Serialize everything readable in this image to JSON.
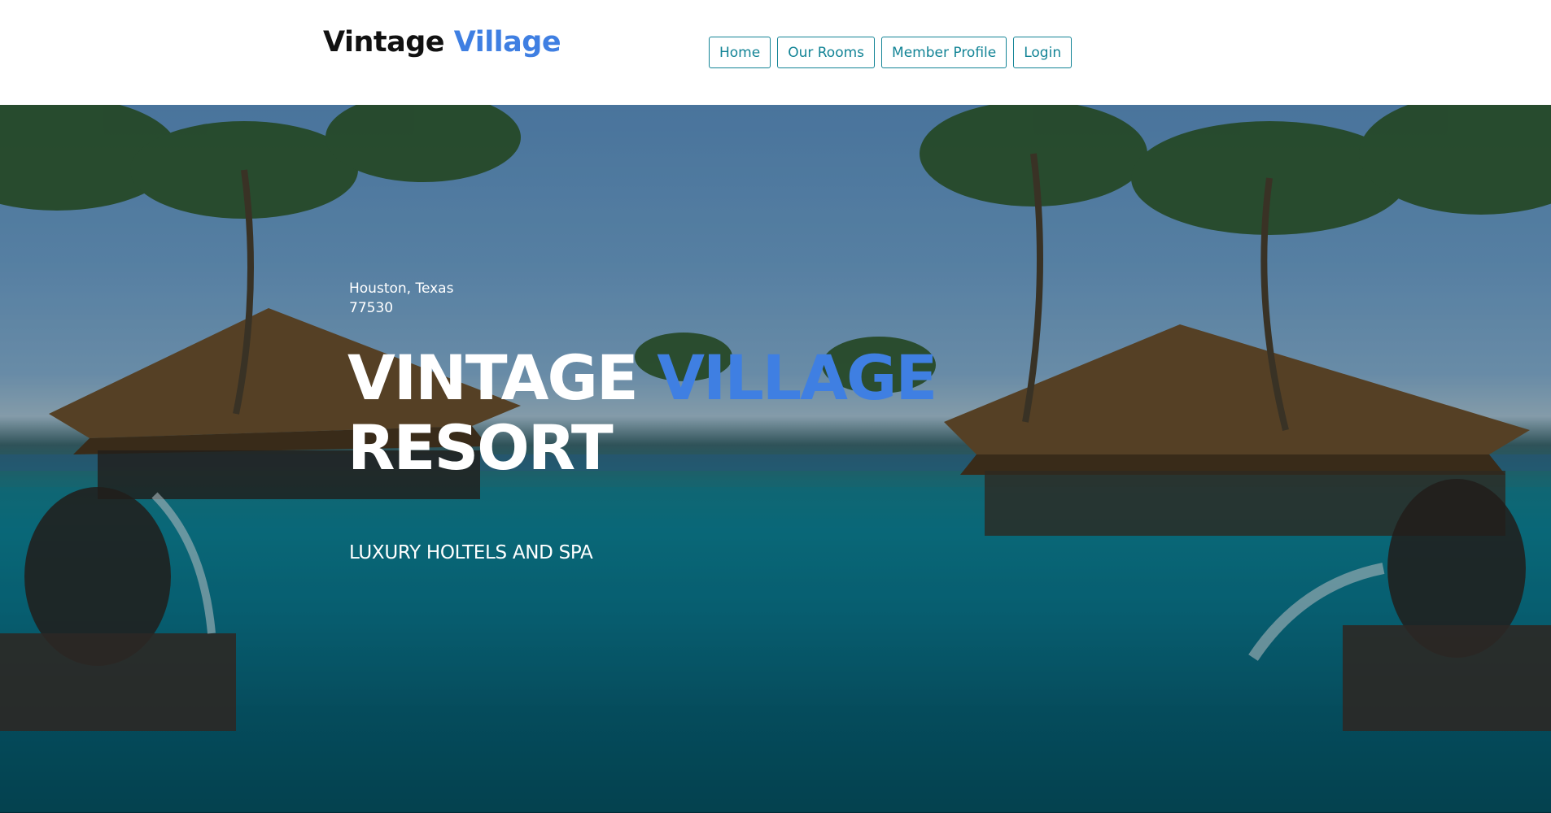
{
  "header": {
    "brand_part1": "Vintage",
    "brand_part2": "Village",
    "nav": [
      {
        "label": "Home"
      },
      {
        "label": "Our Rooms"
      },
      {
        "label": "Member Profile"
      },
      {
        "label": "Login"
      }
    ]
  },
  "hero": {
    "location_line1": "Houston, Texas",
    "location_line2": "77530",
    "title_part1": "VINTAGE",
    "title_part2": "VILLAGE",
    "title_line2": "RESORT",
    "tagline": "LUXURY HOLTELS AND SPA"
  },
  "colors": {
    "accent": "#3f7fe2",
    "nav_border": "#138496",
    "nav_text": "#138496"
  }
}
